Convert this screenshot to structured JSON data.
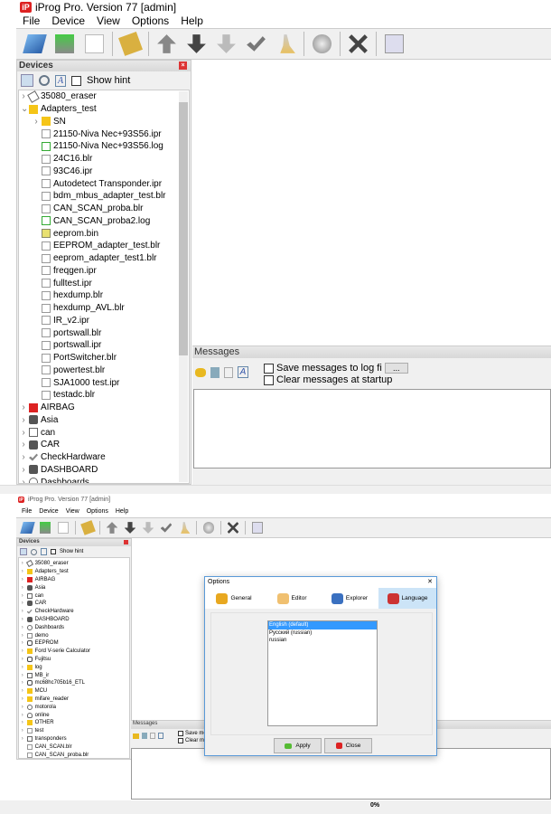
{
  "app": {
    "title": "iProg Pro. Version 77 [admin]",
    "logo": "iP"
  },
  "menu": [
    "File",
    "Device",
    "View",
    "Options",
    "Help"
  ],
  "toolbar_icons": [
    "open-folder-icon",
    "save-disk-icon",
    "new-file-icon",
    "chip-icon",
    "upload-arrow-icon",
    "download-arrow-icon",
    "read-arrow-icon",
    "verify-check-icon",
    "erase-broom-icon",
    "disc-icon",
    "stop-x-icon",
    "calculator-icon"
  ],
  "devices": {
    "title": "Devices",
    "show_hint": "Show hint"
  },
  "tree_top": [
    {
      "label": "35080_eraser",
      "level": 0,
      "icon": "eraser",
      "exp": "›"
    },
    {
      "label": "Adapters_test",
      "level": 0,
      "icon": "folder",
      "exp": "⌄"
    },
    {
      "label": "SN",
      "level": 1,
      "icon": "folder",
      "exp": "›"
    },
    {
      "label": "21150-Niva Nec+93S56.ipr",
      "level": 1,
      "icon": "file"
    },
    {
      "label": "21150-Niva Nec+93S56.log",
      "level": 1,
      "icon": "log"
    },
    {
      "label": "24C16.blr",
      "level": 1,
      "icon": "file"
    },
    {
      "label": "93C46.ipr",
      "level": 1,
      "icon": "file"
    },
    {
      "label": "Autodetect Transponder.ipr",
      "level": 1,
      "icon": "file"
    },
    {
      "label": "bdm_mbus_adapter_test.blr",
      "level": 1,
      "icon": "file"
    },
    {
      "label": "CAN_SCAN_proba.blr",
      "level": 1,
      "icon": "file"
    },
    {
      "label": "CAN_SCAN_proba2.log",
      "level": 1,
      "icon": "log"
    },
    {
      "label": "eeprom.bin",
      "level": 1,
      "icon": "bin"
    },
    {
      "label": "EEPROM_adapter_test.blr",
      "level": 1,
      "icon": "file"
    },
    {
      "label": "eeprom_adapter_test1.blr",
      "level": 1,
      "icon": "file"
    },
    {
      "label": "freqgen.ipr",
      "level": 1,
      "icon": "file"
    },
    {
      "label": "fulltest.ipr",
      "level": 1,
      "icon": "file"
    },
    {
      "label": "hexdump.blr",
      "level": 1,
      "icon": "file"
    },
    {
      "label": "hexdump_AVL.blr",
      "level": 1,
      "icon": "file"
    },
    {
      "label": "IR_v2.ipr",
      "level": 1,
      "icon": "file"
    },
    {
      "label": "portswall.blr",
      "level": 1,
      "icon": "file"
    },
    {
      "label": "portswall.ipr",
      "level": 1,
      "icon": "file"
    },
    {
      "label": "PortSwitcher.blr",
      "level": 1,
      "icon": "file"
    },
    {
      "label": "powertest.blr",
      "level": 1,
      "icon": "file"
    },
    {
      "label": "SJA1000 test.ipr",
      "level": 1,
      "icon": "file"
    },
    {
      "label": "testadc.blr",
      "level": 1,
      "icon": "file"
    },
    {
      "label": "AIRBAG",
      "level": 0,
      "icon": "airbag",
      "exp": "›"
    },
    {
      "label": "Asia",
      "level": 0,
      "icon": "car",
      "exp": "›"
    },
    {
      "label": "can",
      "level": 0,
      "icon": "plug",
      "exp": "›"
    },
    {
      "label": "CAR",
      "level": 0,
      "icon": "car",
      "exp": "›"
    },
    {
      "label": "CheckHardware",
      "level": 0,
      "icon": "check",
      "exp": "›"
    },
    {
      "label": "DASHBOARD",
      "level": 0,
      "icon": "car",
      "exp": "›"
    },
    {
      "label": "Dashboards",
      "level": 0,
      "icon": "gauge",
      "exp": "›"
    }
  ],
  "tree_bottom": [
    {
      "label": "35080_eraser",
      "icon": "eraser",
      "exp": "›"
    },
    {
      "label": "Adapters_test",
      "icon": "folder",
      "exp": "›"
    },
    {
      "label": "AIRBAG",
      "icon": "airbag",
      "exp": "›"
    },
    {
      "label": "Asia",
      "icon": "car",
      "exp": "›"
    },
    {
      "label": "can",
      "icon": "plug",
      "exp": "›"
    },
    {
      "label": "CAR",
      "icon": "car",
      "exp": "›"
    },
    {
      "label": "CheckHardware",
      "icon": "check",
      "exp": "›"
    },
    {
      "label": "DASHBOARD",
      "icon": "car",
      "exp": "›"
    },
    {
      "label": "Dashboards",
      "icon": "gauge",
      "exp": "›"
    },
    {
      "label": "demo",
      "icon": "folder-open",
      "exp": "›"
    },
    {
      "label": "EEPROM",
      "icon": "chip",
      "exp": "›"
    },
    {
      "label": "Ford V-serie Calculator",
      "icon": "folder",
      "exp": "›"
    },
    {
      "label": "Fujitsu",
      "icon": "chip",
      "exp": "›"
    },
    {
      "label": "log",
      "icon": "folder",
      "exp": "›"
    },
    {
      "label": "MB_ir",
      "icon": "plug",
      "exp": "›"
    },
    {
      "label": "mc68hc705b16_ETL",
      "icon": "chip",
      "exp": "›"
    },
    {
      "label": "MCU",
      "icon": "folder",
      "exp": "›"
    },
    {
      "label": "mifare_reader",
      "icon": "folder",
      "exp": "›"
    },
    {
      "label": "motorola",
      "icon": "gauge",
      "exp": "›"
    },
    {
      "label": "online",
      "icon": "cloud",
      "exp": "›"
    },
    {
      "label": "OTHER",
      "icon": "folder",
      "exp": "›"
    },
    {
      "label": "test",
      "icon": "file",
      "exp": "›"
    },
    {
      "label": "transponders",
      "icon": "plug",
      "exp": "›"
    },
    {
      "label": "CAN_SCAN.blr",
      "icon": "file"
    },
    {
      "label": "CAN_SCAN_proba.blr",
      "icon": "file"
    }
  ],
  "messages": {
    "title": "Messages",
    "save_log": "Save messages to log fi",
    "browse": "...",
    "clear_startup": "Clear messages at startup",
    "save_log_short": "Save me",
    "clear_short": "Clear me"
  },
  "options_dialog": {
    "title": "Options",
    "close": "✕",
    "tabs": [
      {
        "label": "General"
      },
      {
        "label": "Editor"
      },
      {
        "label": "Explorer"
      },
      {
        "label": "Language",
        "active": true
      }
    ],
    "languages": [
      "English (default)",
      "Русский (russian)",
      "russian"
    ],
    "selected": 0,
    "apply": "Apply",
    "close_btn": "Close"
  },
  "status": {
    "progress": "0%"
  },
  "colors": {
    "accent": "#3399ff",
    "folder": "#f5c518",
    "close_red": "#d33"
  }
}
